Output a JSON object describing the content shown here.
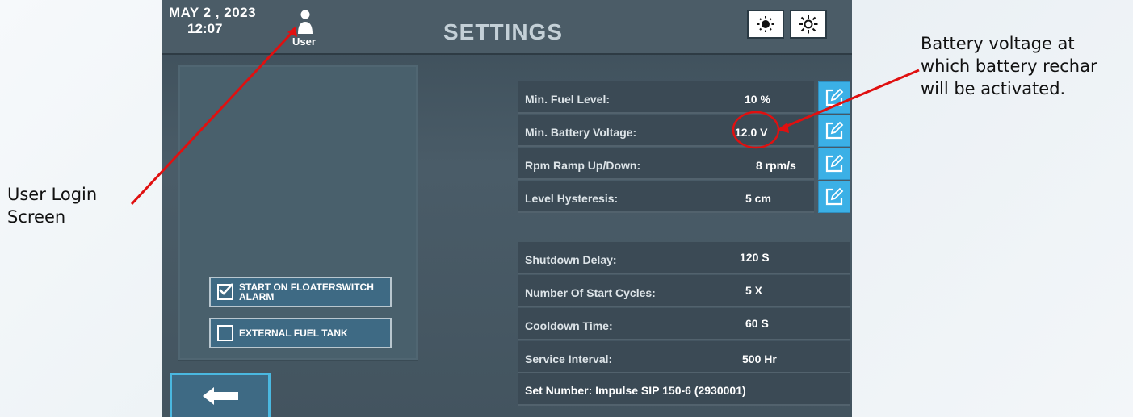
{
  "annotations": {
    "left_line1": "User Login",
    "left_line2": "Screen",
    "right_line1": "Battery voltage at",
    "right_line2": "which battery rechar",
    "right_line3": "will be activated."
  },
  "header": {
    "date": "MAY  2 , 2023",
    "time": "12:07",
    "user_label": "User",
    "title": "SETTINGS",
    "brightness_low_icon": "sun-small-icon",
    "brightness_high_icon": "sun-large-icon"
  },
  "options": {
    "floaterswitch_label_line1": "START ON FLOATERSWITCH",
    "floaterswitch_label_line2": "ALARM",
    "floaterswitch_checked": true,
    "external_fuel_label": "EXTERNAL FUEL TANK",
    "external_fuel_checked": false
  },
  "editable_settings": [
    {
      "label": "Min. Fuel Level:",
      "value": "10 %"
    },
    {
      "label": "Min. Battery Voltage:",
      "value": "12.0 V"
    },
    {
      "label": "Rpm Ramp Up/Down:",
      "value": "8 rpm/s"
    },
    {
      "label": "Level Hysteresis:",
      "value": "5 cm"
    }
  ],
  "info_settings": [
    {
      "label": "Shutdown Delay:",
      "value": "120 S"
    },
    {
      "label": "Number Of Start Cycles:",
      "value": "5 X"
    },
    {
      "label": "Cooldown Time:",
      "value": "60 S"
    },
    {
      "label": "Service Interval:",
      "value": "500 Hr"
    }
  ],
  "set_number": "Set Number:  Impulse SIP 150-6 (2930001)",
  "colors": {
    "accent_blue": "#3bb0e6",
    "annotation_red": "#e01010",
    "screen_bg": "#43545f"
  }
}
